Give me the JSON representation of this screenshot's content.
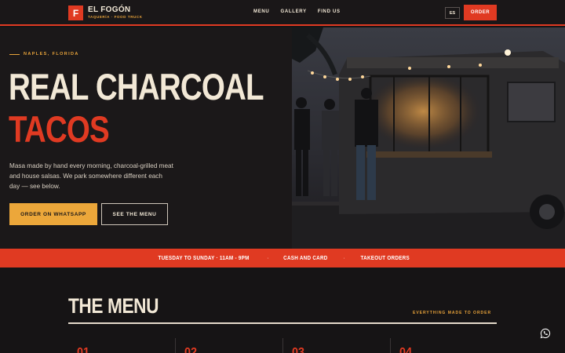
{
  "brand": {
    "mark": "F",
    "name": "EL FOGÓN",
    "tagline": "TAQUERÍA · FOOD TRUCK"
  },
  "nav": {
    "links": [
      "MENU",
      "GALLERY",
      "FIND US"
    ],
    "lang": "ES",
    "order_label": "ORDER"
  },
  "hero": {
    "eyebrow": "NAPLES, FLORIDA",
    "title_line1": "REAL CHARCOAL",
    "title_line2": "TACOS",
    "lede": "Masa made by hand every morning, charcoal-grilled meat and house salsas. We park somewhere different each day — see below.",
    "primary_cta": "ORDER ON WHATSAPP",
    "secondary_cta": "SEE THE MENU"
  },
  "band": {
    "items": [
      "TUESDAY TO SUNDAY · 11AM - 9PM",
      "CASH AND CARD",
      "TAKEOUT ORDERS"
    ],
    "separator": "·"
  },
  "menu": {
    "title": "THE MENU",
    "subtitle": "EVERYTHING MADE TO ORDER",
    "columns": [
      "01",
      "02",
      "03",
      "04"
    ]
  },
  "colors": {
    "accent_red": "#e03a22",
    "accent_amber": "#eca73a",
    "cream": "#f2e8d6",
    "background": "#171516"
  },
  "icons": {
    "floating": "whatsapp-icon"
  }
}
